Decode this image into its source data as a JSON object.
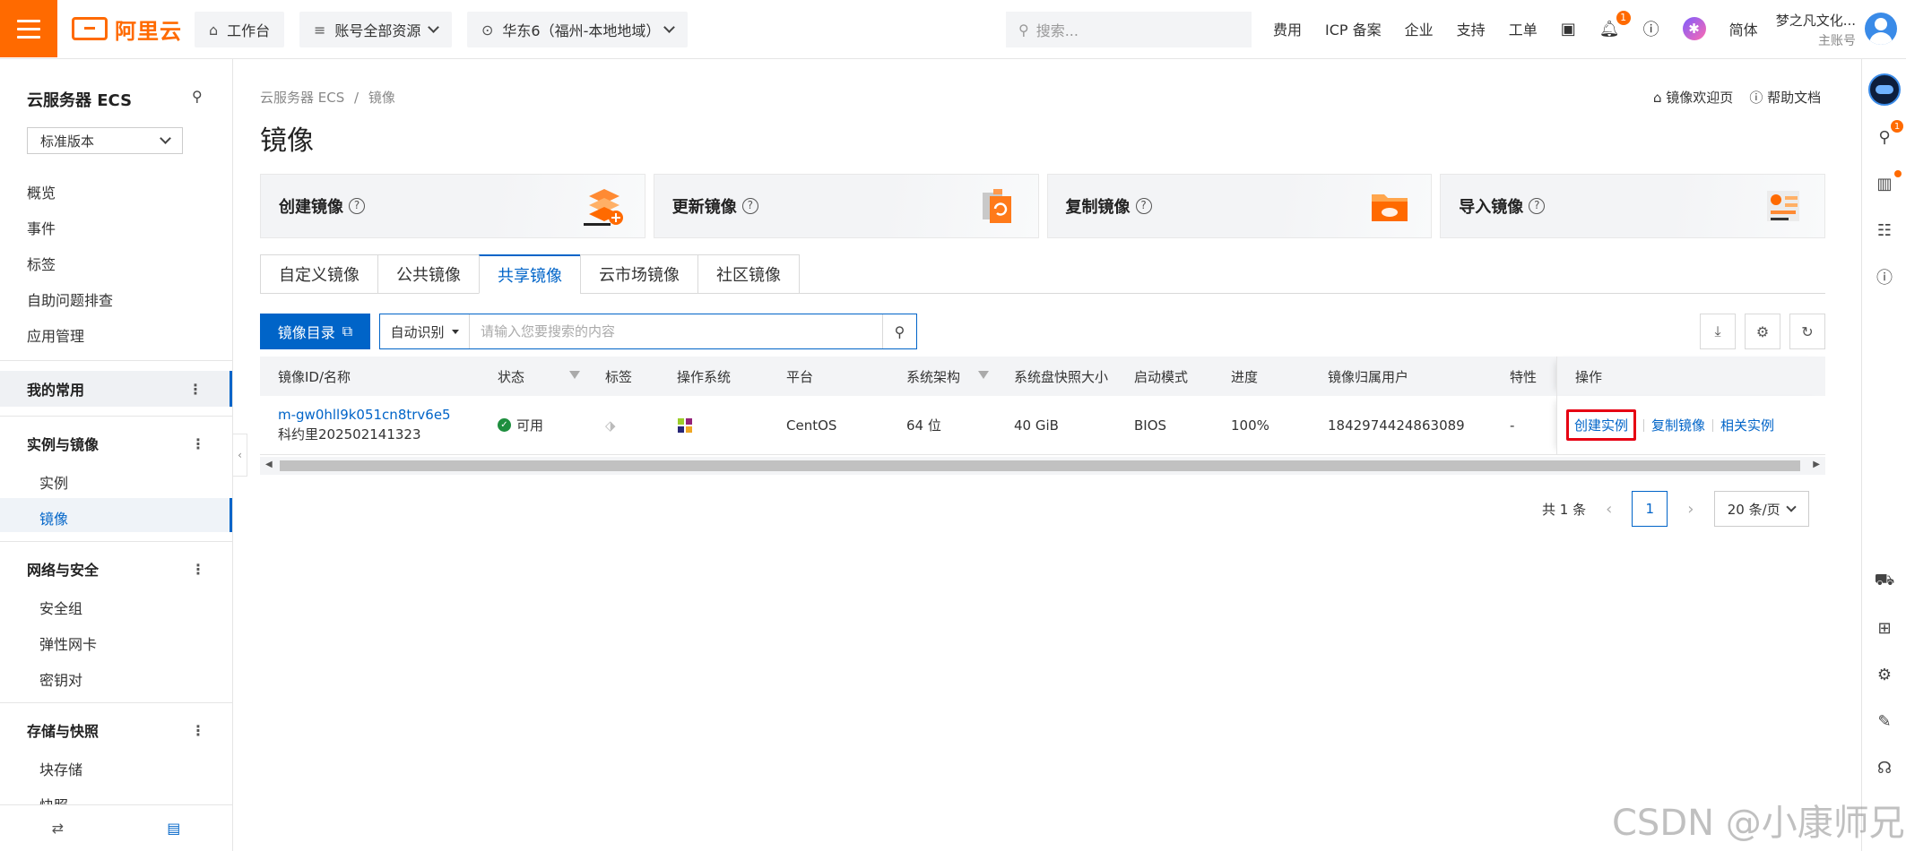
{
  "topbar": {
    "brand": "阿里云",
    "workbench": "工作台",
    "resource_scope": "账号全部资源",
    "region": "华东6（福州-本地地域）",
    "search_placeholder": "搜索...",
    "links": [
      "费用",
      "ICP 备案",
      "企业",
      "支持",
      "工单"
    ],
    "notification_count": "1",
    "language": "简体",
    "account_name": "梦之凡文化...",
    "account_type": "主账号"
  },
  "sidebar": {
    "title": "云服务器 ECS",
    "version_select": "标准版本",
    "top_items": [
      "概览",
      "事件",
      "标签",
      "自助问题排查",
      "应用管理"
    ],
    "groups": [
      {
        "label": "我的常用",
        "items": []
      },
      {
        "label": "实例与镜像",
        "items": [
          "实例",
          "镜像"
        ]
      },
      {
        "label": "网络与安全",
        "items": [
          "安全组",
          "弹性网卡",
          "密钥对"
        ]
      },
      {
        "label": "存储与快照",
        "items": [
          "块存储",
          "快照"
        ]
      }
    ],
    "active_item": "镜像"
  },
  "breadcrumb": {
    "parent": "云服务器 ECS",
    "sep": "/",
    "current": "镜像"
  },
  "page_title": "镜像",
  "help_links": {
    "welcome": "镜像欢迎页",
    "docs": "帮助文档"
  },
  "action_cards": [
    {
      "label": "创建镜像"
    },
    {
      "label": "更新镜像"
    },
    {
      "label": "复制镜像"
    },
    {
      "label": "导入镜像"
    }
  ],
  "tabs": [
    "自定义镜像",
    "公共镜像",
    "共享镜像",
    "云市场镜像",
    "社区镜像"
  ],
  "active_tab": "共享镜像",
  "toolbar": {
    "catalog_button": "镜像目录",
    "search_type": "自动识别",
    "search_placeholder": "请输入您要搜索的内容"
  },
  "table": {
    "headers": [
      "镜像ID/名称",
      "状态",
      "标签",
      "操作系统",
      "平台",
      "系统架构",
      "系统盘快照大小",
      "启动模式",
      "进度",
      "镜像归属用户",
      "特性",
      "操作"
    ],
    "rows": [
      {
        "id": "m-gw0hll9k051cn8trv6e5",
        "name": "科约里202502141323",
        "status": "可用",
        "platform": "CentOS",
        "arch": "64 位",
        "size": "40 GiB",
        "boot": "BIOS",
        "progress": "100%",
        "owner": "1842974424863089",
        "feature": "-",
        "ops": [
          "创建实例",
          "复制镜像",
          "相关实例"
        ]
      }
    ]
  },
  "pagination": {
    "total": "共 1 条",
    "page": "1",
    "page_size": "20 条/页"
  },
  "watermark": "CSDN @小康师兄",
  "colors": {
    "brand": "#ff6a00",
    "primary": "#0064c8",
    "success": "#1e8e3e",
    "highlight": "#e60012"
  }
}
